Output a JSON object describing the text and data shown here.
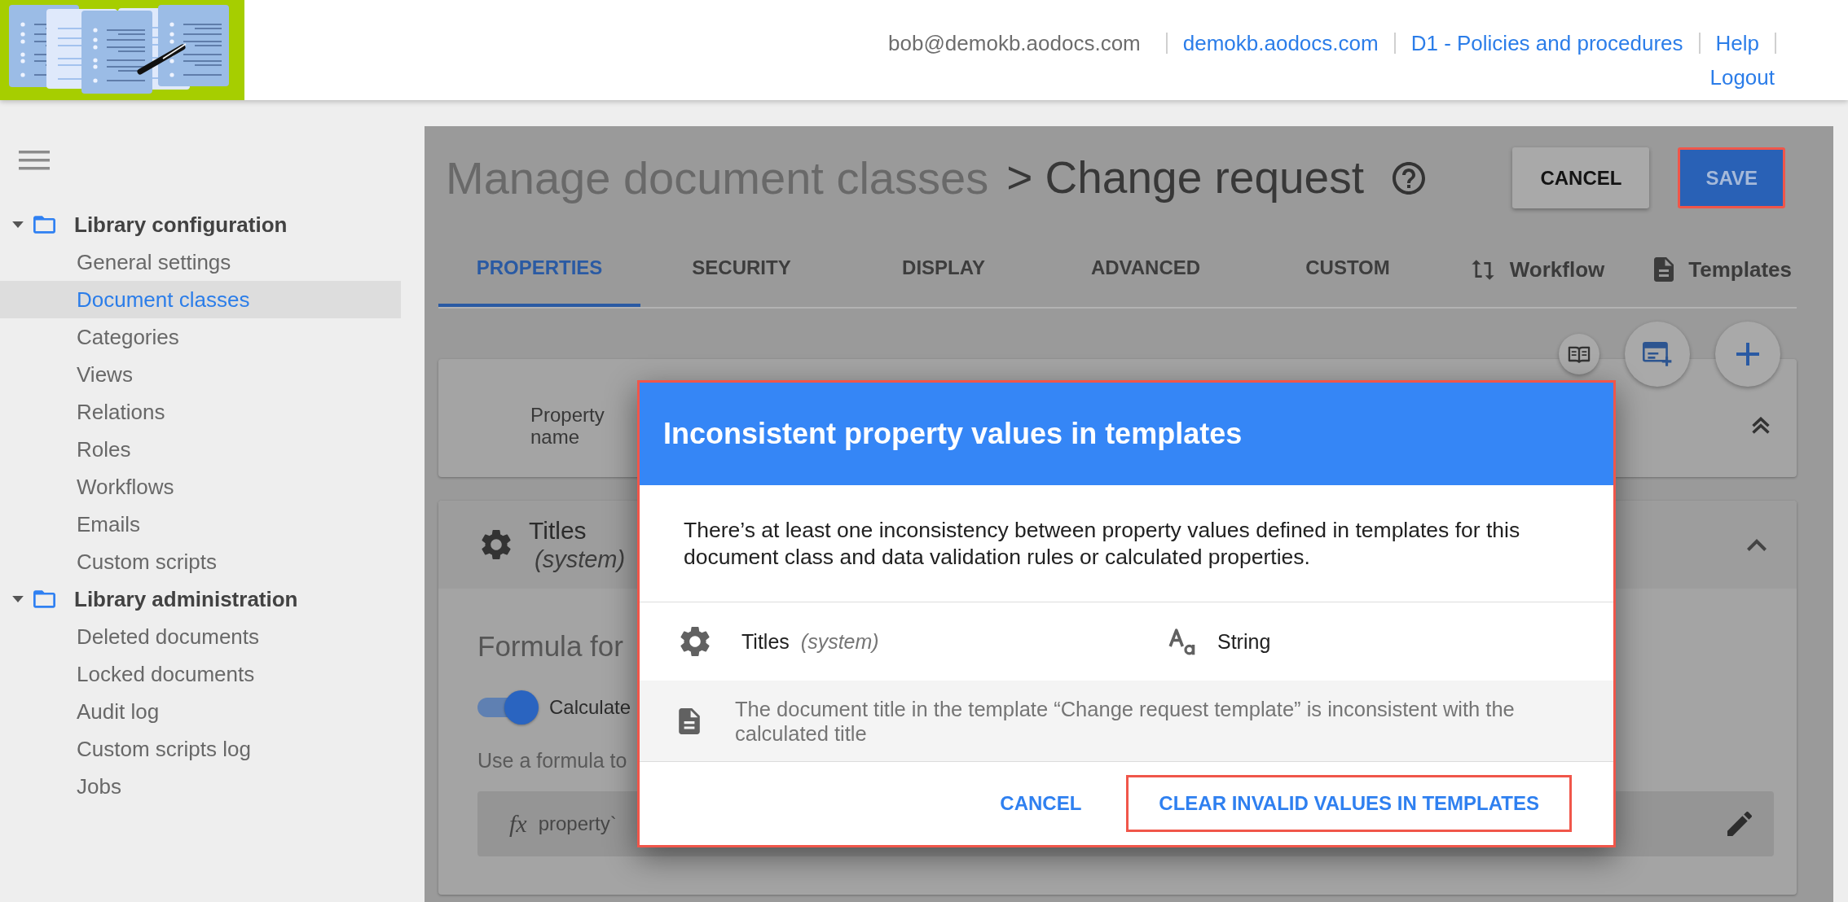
{
  "header": {
    "user": "bob@demokb.aodocs.com",
    "links": [
      {
        "label": "demokb.aodocs.com"
      },
      {
        "label": "D1 - Policies and procedures"
      },
      {
        "label": "Help"
      },
      {
        "label": "Logout"
      }
    ]
  },
  "sidebar": {
    "sections": [
      {
        "label": "Library configuration",
        "expanded": true,
        "children": [
          {
            "label": "General settings",
            "selected": false
          },
          {
            "label": "Document classes",
            "selected": true
          },
          {
            "label": "Categories",
            "selected": false
          },
          {
            "label": "Views",
            "selected": false
          },
          {
            "label": "Relations",
            "selected": false
          },
          {
            "label": "Roles",
            "selected": false
          },
          {
            "label": "Workflows",
            "selected": false
          },
          {
            "label": "Emails",
            "selected": false
          },
          {
            "label": "Custom scripts",
            "selected": false
          }
        ]
      },
      {
        "label": "Library administration",
        "expanded": true,
        "children": [
          {
            "label": "Deleted documents",
            "selected": false
          },
          {
            "label": "Locked documents",
            "selected": false
          },
          {
            "label": "Audit log",
            "selected": false
          },
          {
            "label": "Custom scripts log",
            "selected": false
          },
          {
            "label": "Jobs",
            "selected": false
          }
        ]
      }
    ]
  },
  "page": {
    "breadcrumb": "Manage document classes",
    "title": "> Change request",
    "buttons": [
      {
        "label": "CANCEL",
        "kind": "secondary",
        "highlighted": false
      },
      {
        "label": "SAVE",
        "kind": "primary",
        "highlighted": true
      }
    ]
  },
  "tabs": [
    {
      "label": "PROPERTIES",
      "selected": true
    },
    {
      "label": "SECURITY",
      "selected": false
    },
    {
      "label": "DISPLAY",
      "selected": false
    },
    {
      "label": "ADVANCED",
      "selected": false
    },
    {
      "label": "CUSTOM",
      "selected": false
    }
  ],
  "tab_links": [
    {
      "label": "Workflow"
    },
    {
      "label": "Templates"
    }
  ],
  "property_table": {
    "columns": [
      "Property name"
    ]
  },
  "property": {
    "name": "Titles",
    "note": "(system)",
    "expanded": true,
    "formula_heading": "Formula for",
    "toggle": {
      "label": "Calculate",
      "on": true
    },
    "hint": "Use a formula to",
    "formula": {
      "prefix": "fx",
      "value": "property`"
    }
  },
  "dialog": {
    "title": "Inconsistent property values in templates",
    "message": "There’s at least one inconsistency between property values defined in templates for this document class and data validation rules or calculated properties.",
    "highlighted": true,
    "property": {
      "name": "Titles",
      "note": "(system)",
      "type": "String"
    },
    "issues": [
      {
        "text": "The document title in the template “Change request template” is inconsistent with the calculated title"
      }
    ],
    "buttons": [
      {
        "label": "CANCEL",
        "highlighted": false
      },
      {
        "label": "CLEAR INVALID VALUES IN TEMPLATES",
        "highlighted": true
      }
    ]
  }
}
